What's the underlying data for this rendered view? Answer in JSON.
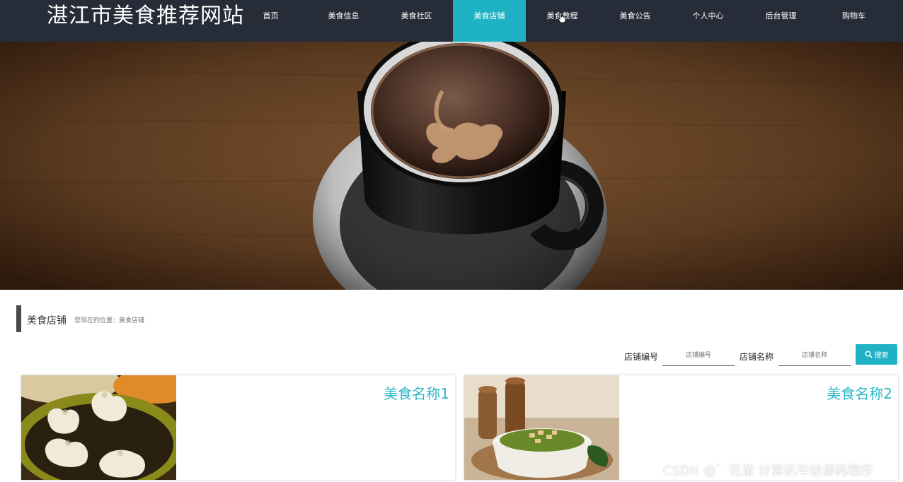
{
  "header": {
    "site_title": "湛江市美食推荐网站",
    "nav": [
      {
        "label": "首页"
      },
      {
        "label": "美食信息"
      },
      {
        "label": "美食社区"
      },
      {
        "label": "美食店铺"
      },
      {
        "label": "美食教程"
      },
      {
        "label": "美食公告"
      },
      {
        "label": "个人中心"
      },
      {
        "label": "后台管理"
      },
      {
        "label": "购物车"
      }
    ],
    "active_index": 3
  },
  "section": {
    "title": "美食店铺",
    "breadcrumb": "您现在的位置：美食店铺"
  },
  "search": {
    "field1_label": "店铺编号",
    "field1_placeholder": "店铺编号",
    "field2_label": "店铺名称",
    "field2_placeholder": "店铺名称",
    "button_label": "搜索"
  },
  "cards": [
    {
      "name": "美食名称1",
      "image": "dumplings-photo"
    },
    {
      "name": "美食名称2",
      "image": "soup-bowl-photo"
    }
  ],
  "watermark": "CSDN @゛花昔  计算机毕设源码程序",
  "colors": {
    "header_bg": "#272d38",
    "accent": "#1fb2c5",
    "card_title": "#2bb7c9"
  }
}
